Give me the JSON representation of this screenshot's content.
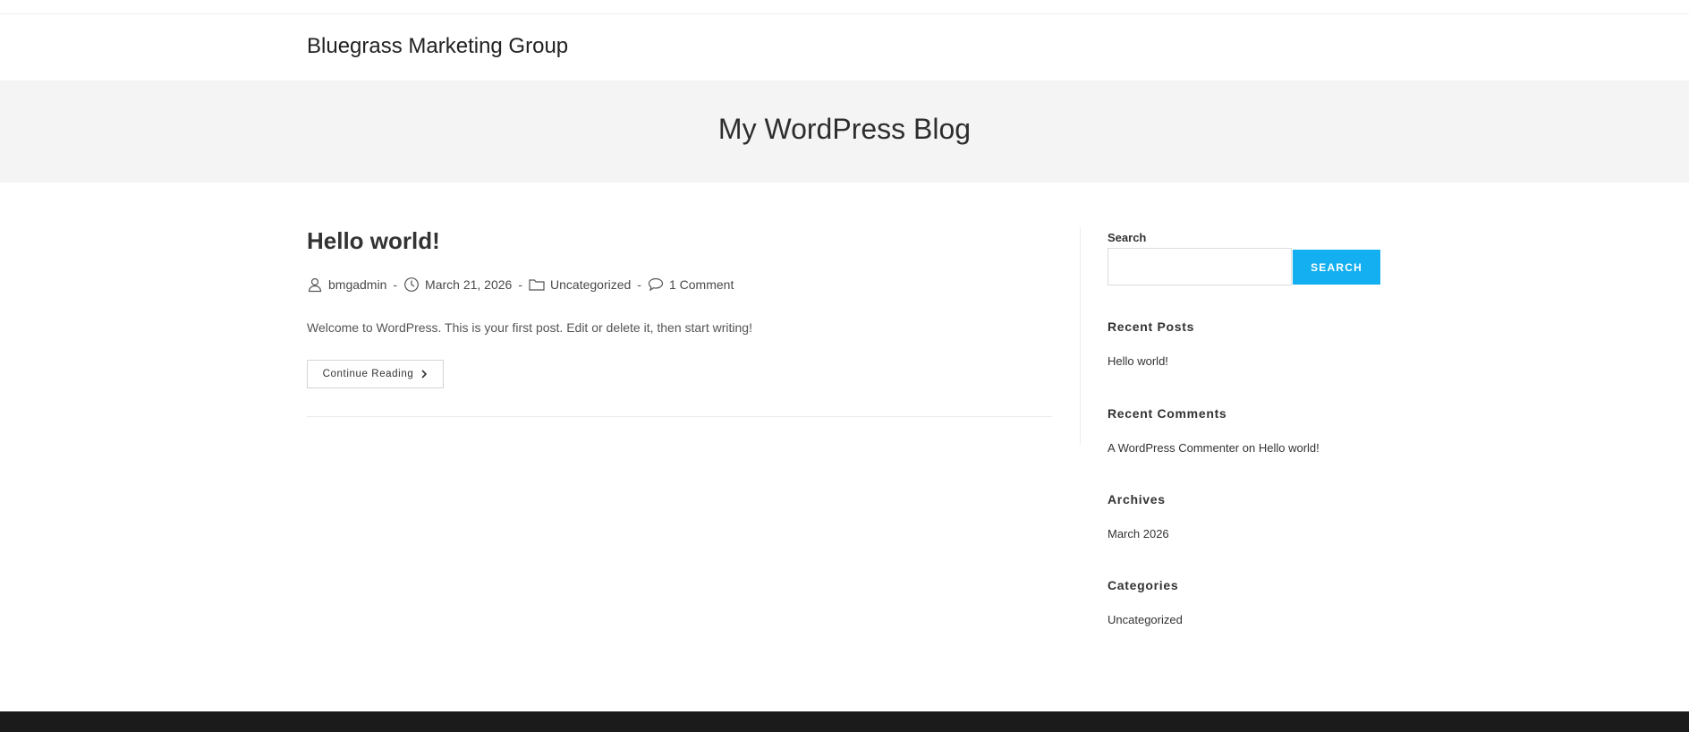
{
  "header": {
    "site_title": "Bluegrass Marketing Group"
  },
  "hero": {
    "title": "My WordPress Blog"
  },
  "post": {
    "title": "Hello world!",
    "author": "bmgadmin",
    "date": "March 21, 2026",
    "category": "Uncategorized",
    "comments": "1 Comment",
    "separator": "-",
    "excerpt": "Welcome to WordPress. This is your first post. Edit or delete it, then start writing!",
    "continue_label": "Continue Reading"
  },
  "sidebar": {
    "search": {
      "label": "Search",
      "value": "",
      "button_label": "SEARCH"
    },
    "recent_posts": {
      "title": "Recent Posts",
      "items": [
        "Hello world!"
      ]
    },
    "recent_comments": {
      "title": "Recent Comments",
      "author": "A WordPress Commenter",
      "on": "on",
      "post": "Hello world!"
    },
    "archives": {
      "title": "Archives",
      "items": [
        "March 2026"
      ]
    },
    "categories": {
      "title": "Categories",
      "items": [
        "Uncategorized"
      ]
    }
  },
  "icons": {
    "author": "user-icon",
    "date": "clock-icon",
    "category": "folder-icon",
    "comments": "comment-icon",
    "continue": "chevron-right-icon"
  },
  "colors": {
    "accent": "#13aff0",
    "hero_bg": "#f4f4f4",
    "footer_bg": "#1b1b1b"
  }
}
